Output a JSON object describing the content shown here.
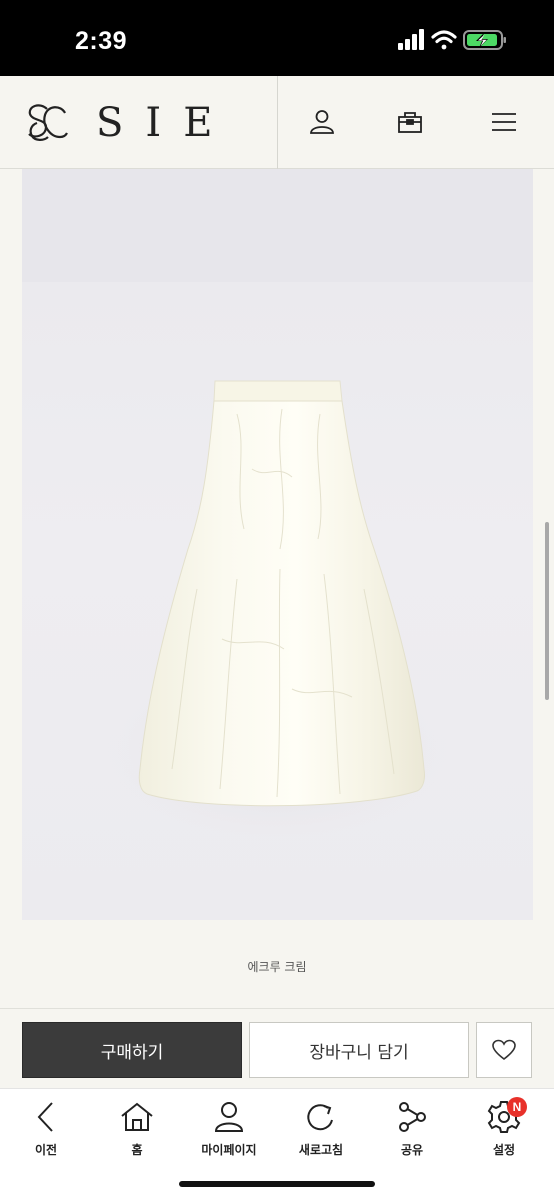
{
  "status_bar": {
    "time": "2:39"
  },
  "header": {
    "brand": "SIE"
  },
  "product": {
    "caption": "에크루 크림"
  },
  "buy_bar": {
    "buy_label": "구매하기",
    "cart_label": "장바구니 담기"
  },
  "bottom_nav": {
    "back": "이전",
    "home": "홈",
    "mypage": "마이페이지",
    "refresh": "새로고침",
    "share": "공유",
    "settings": "설정",
    "settings_badge": "N"
  },
  "colors": {
    "buy_button": "#3b3b3b",
    "badge": "#e8312a",
    "page_bg": "#f6f5f0"
  }
}
